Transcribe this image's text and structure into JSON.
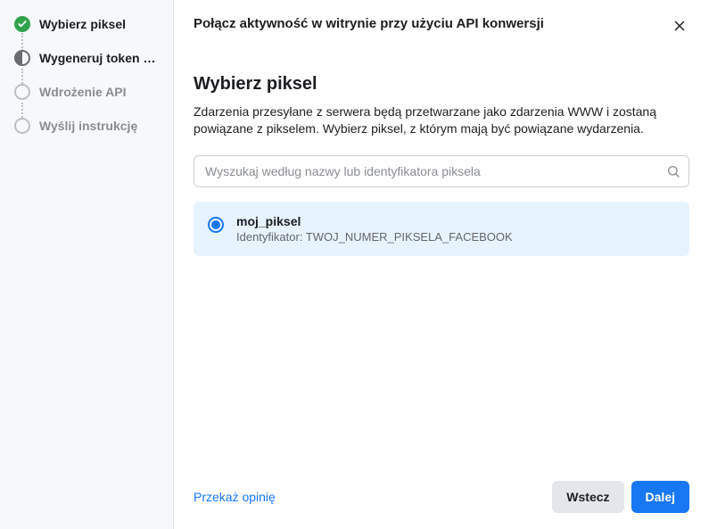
{
  "sidebar": {
    "steps": [
      {
        "label": "Wybierz piksel",
        "state": "done"
      },
      {
        "label": "Wygeneruj token do…",
        "state": "current"
      },
      {
        "label": "Wdrożenie API",
        "state": "pending"
      },
      {
        "label": "Wyślij instrukcję",
        "state": "pending"
      }
    ]
  },
  "header": {
    "title": "Połącz aktywność w witrynie przy użyciu API konwersji"
  },
  "section": {
    "title": "Wybierz piksel",
    "description": "Zdarzenia przesyłane z serwera będą przetwarzane jako zdarzenia WWW i zostaną powiązane z pikselem. Wybierz piksel, z którym mają być powiązane wydarzenia."
  },
  "search": {
    "placeholder": "Wyszukaj według nazwy lub identyfikatora piksela",
    "value": ""
  },
  "pixel_options": [
    {
      "name": "moj_piksel",
      "id_label": "Identyfikator: TWOJ_NUMER_PIKSELA_FACEBOOK",
      "selected": true
    }
  ],
  "footer": {
    "feedback": "Przekaż opinię",
    "back": "Wstecz",
    "next": "Dalej"
  }
}
